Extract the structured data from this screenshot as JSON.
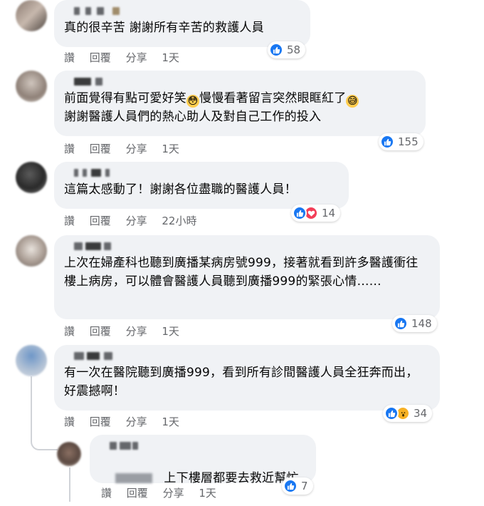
{
  "actions": {
    "like": "讚",
    "reply": "回覆",
    "share": "分享"
  },
  "comments": [
    {
      "text": "真的很辛苦 謝謝所有辛苦的救護人員",
      "time": "1天",
      "reaction_count": "58",
      "reactions": [
        "like-icon"
      ]
    },
    {
      "text_line1": "前面覺得有點可愛好笑",
      "text_line1b": "慢慢看著留言突然眼眶紅了",
      "text_line2": "謝謝醫護人員們的熱心助人及對自己工作的投入",
      "emoji1": "flushed-face-icon",
      "emoji2": "grinning-sweat-icon",
      "time": "1天",
      "reaction_count": "155",
      "reactions": [
        "like-icon"
      ]
    },
    {
      "text": "這篇太感動了！謝謝各位盡職的醫護人員！",
      "time": "22小時",
      "reaction_count": "14",
      "reactions": [
        "like-icon",
        "love-icon"
      ]
    },
    {
      "text": "上次在婦產科也聽到廣播某病房號999，接著就看到許多醫護衝往樓上病房，可以體會醫護人員聽到廣播999的緊張心情……",
      "time": "1天",
      "reaction_count": "148",
      "reactions": [
        "like-icon"
      ]
    },
    {
      "text": "有一次在醫院聽到廣播999，看到所有診間醫護人員全狂奔而出，好震撼啊！",
      "time": "1天",
      "reaction_count": "34",
      "reactions": [
        "like-icon",
        "wow-icon"
      ]
    },
    {
      "text": "上下樓層都要去救近幫忙",
      "time": "1天",
      "reaction_count": "7",
      "reactions": [
        "like-icon"
      ]
    }
  ],
  "colors": {
    "bubble": "#f0f2f5",
    "like_blue": "#1877f2",
    "love_red": "#f33e58",
    "wow_yellow": "#f7b125",
    "meta_gray": "#65676b"
  }
}
